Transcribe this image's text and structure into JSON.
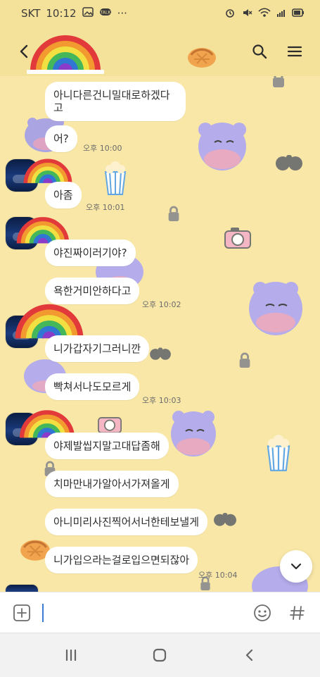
{
  "status": {
    "carrier": "SKT",
    "time": "10:12",
    "more": "···"
  },
  "messages": [
    {
      "text": "아니다른건니밀대로하겠다고"
    },
    {
      "text": "어?"
    },
    {
      "text": "아좀"
    },
    {
      "text": "야진짜이러기야?"
    },
    {
      "text": "욕한거미안하다고"
    },
    {
      "text": "니가갑자기그러니깐"
    },
    {
      "text": "빡쳐서나도모르게"
    },
    {
      "text": "야제발씹지말고대답좀해"
    },
    {
      "text": "치마만내가알아서가져올게"
    },
    {
      "text": "아니미리사진찍어서너한테보낼게"
    },
    {
      "text": "니가입으라는걸로입으면되잖아"
    }
  ],
  "times": [
    "오후 10:00",
    "오후 10:01",
    "오후 10:02",
    "오후 10:03",
    "오후 10:04"
  ],
  "colors": {
    "bg": "#f8e7a6",
    "topbar": "#f5e29a",
    "bubble": "#ffffff"
  }
}
